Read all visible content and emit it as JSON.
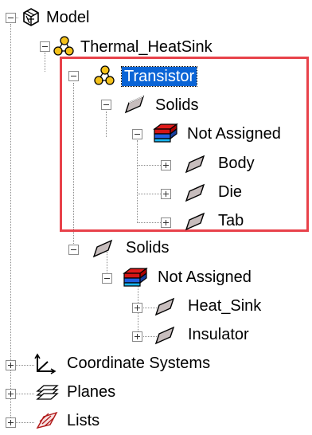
{
  "tree": {
    "model": "Model",
    "thermal": "Thermal_HeatSink",
    "transistor": "Transistor",
    "solids_inner": "Solids",
    "not_assigned_inner": "Not Assigned",
    "body": "Body",
    "die": "Die",
    "tab": "Tab",
    "solids_outer": "Solids",
    "not_assigned_outer": "Not Assigned",
    "heat_sink": "Heat_Sink",
    "insulator": "Insulator",
    "coord": "Coordinate Systems",
    "planes": "Planes",
    "lists": "Lists"
  },
  "colors": {
    "selection": "#0a64d6",
    "highlight_box": "#e8424a"
  }
}
